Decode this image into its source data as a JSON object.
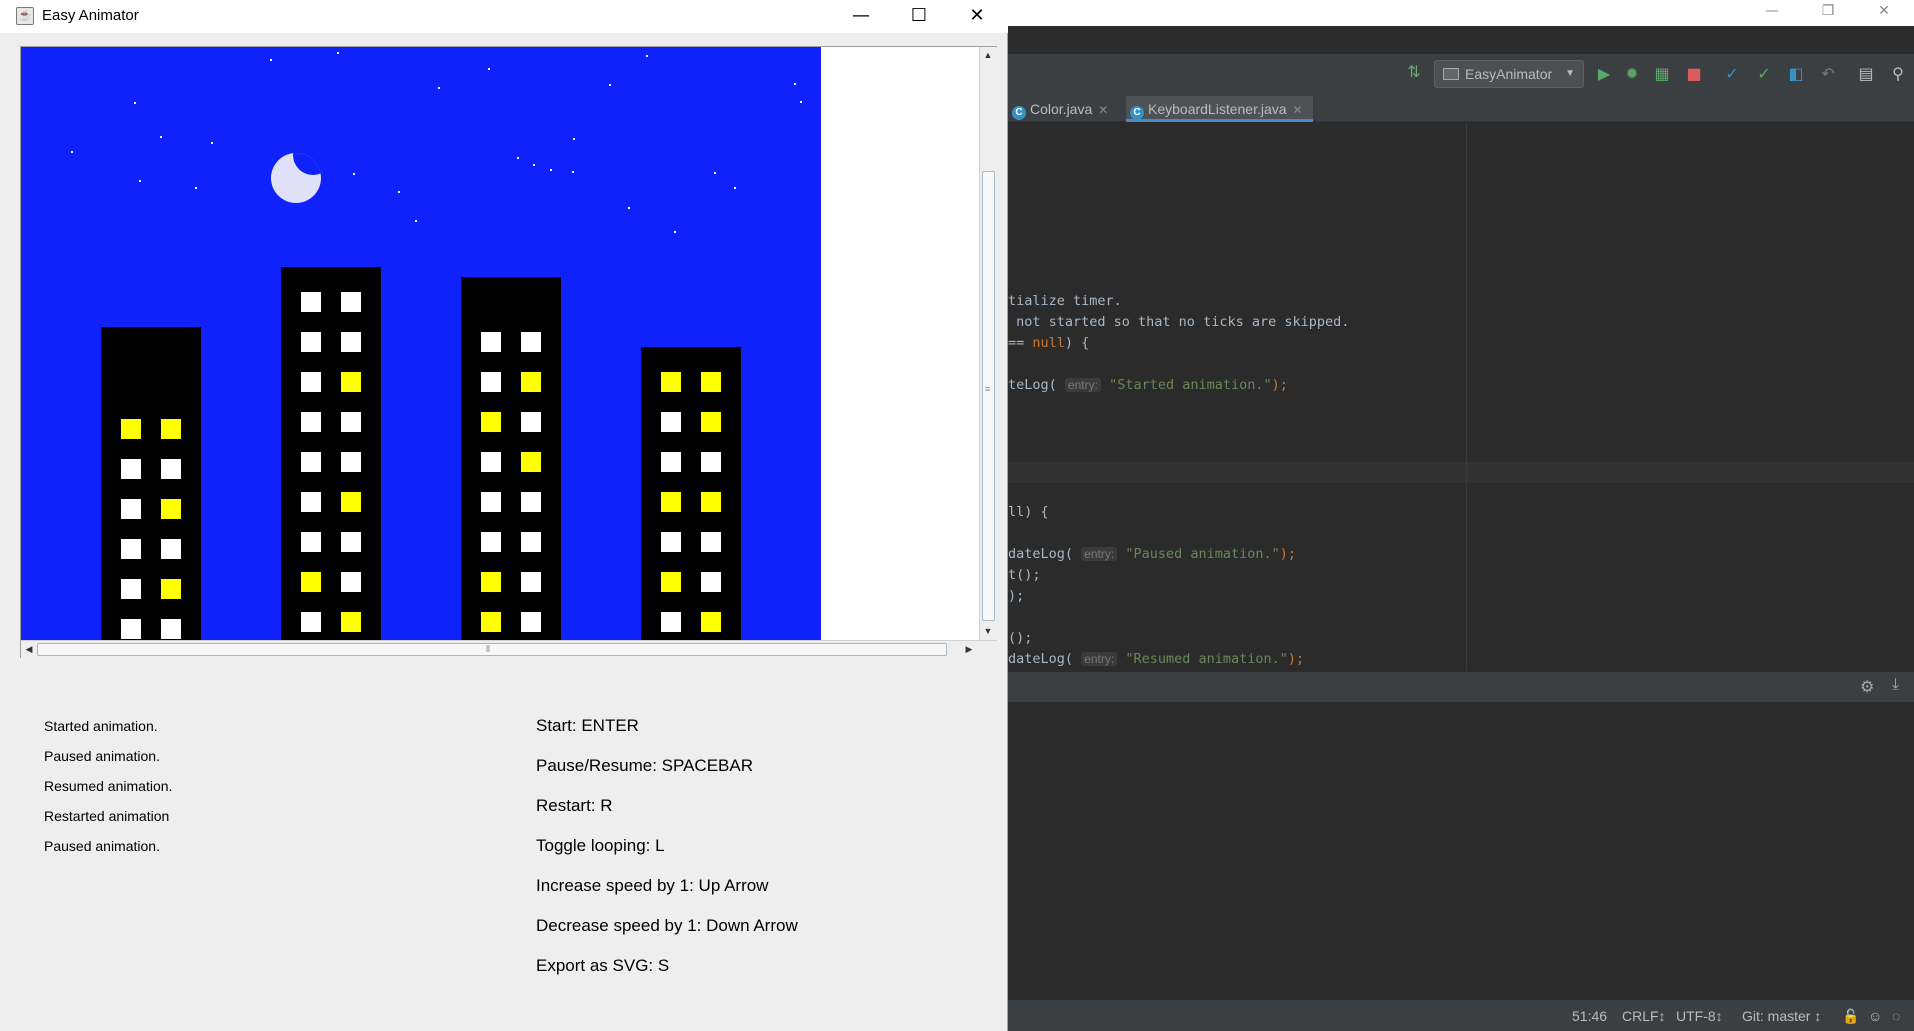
{
  "ide": {
    "run_config": "EasyAnimator",
    "tabs": [
      {
        "label": "Color.java"
      },
      {
        "label": "KeyboardListener.java"
      }
    ],
    "code_lines": {
      "l1": "tialize timer.",
      "l2": " not started so that no ticks are skipped.",
      "l3a": "== ",
      "l3b": "null",
      "l3c": ") {",
      "l4a": "teLog( ",
      "l4hint": "entry:",
      "l4str": "\"Started animation.\"",
      "l4end": ");",
      "l5": "ll) {",
      "l6a": "dateLog( ",
      "l6hint": "entry:",
      "l6str": "\"Paused animation.\"",
      "l6end": ");",
      "l7": "t();",
      "l8": ");",
      "l9": "();",
      "l10a": "dateLog( ",
      "l10hint": "entry:",
      "l10str": "\"Resumed animation.\"",
      "l10end": ");"
    },
    "status": {
      "position": "51:46",
      "line_sep": "CRLF↕",
      "encoding": "UTF-8↕",
      "vcs": "Git: master ↕"
    }
  },
  "app": {
    "title": "Easy Animator",
    "window_controls": {
      "minimize": "—",
      "maximize": "☐",
      "close": "✕"
    },
    "log": [
      "Started animation.",
      "Paused animation.",
      "Resumed animation.",
      "Restarted animation",
      "Paused animation."
    ],
    "controls": [
      "Start: ENTER",
      "Pause/Resume: SPACEBAR",
      "Restart: R",
      "Toggle looping: L",
      "Increase speed by 1: Up Arrow",
      "Decrease speed by 1: Down Arrow",
      "Export as SVG: S"
    ],
    "scene": {
      "sky_color": "#0f22fb",
      "moon_color": "#e0e0f8",
      "lit_window_color": "#ffff00",
      "unlit_window_color": "#ffffff"
    }
  }
}
